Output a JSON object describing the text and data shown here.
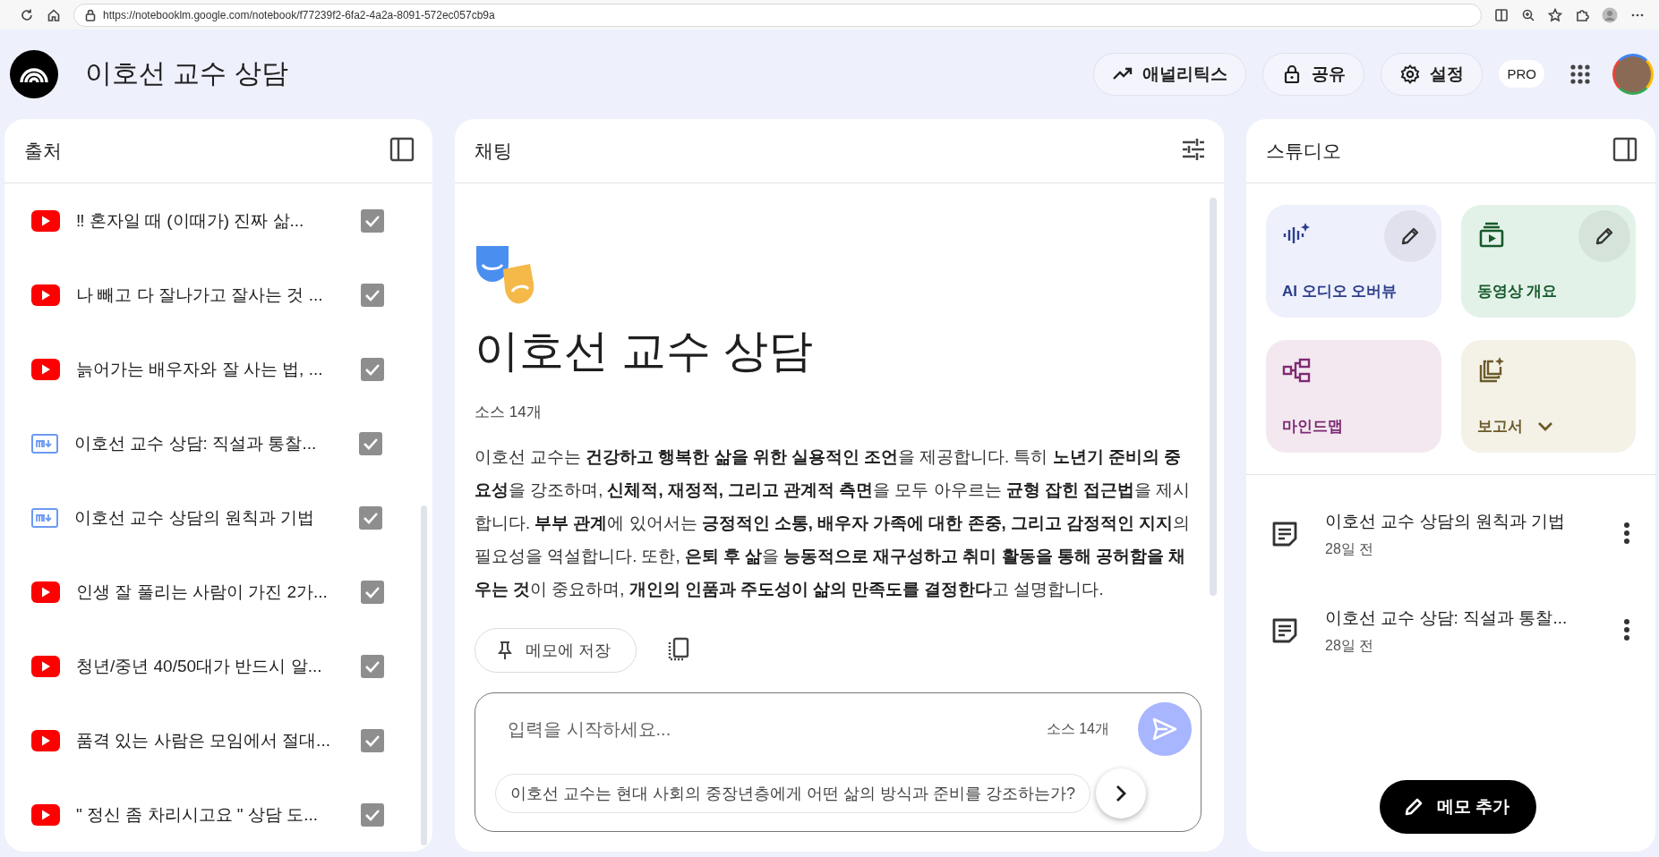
{
  "browser": {
    "url": "https://notebooklm.google.com/notebook/f77239f2-6fa2-4a2a-8091-572ec057cb9a"
  },
  "header": {
    "title": "이호선 교수 상담",
    "buttons": [
      {
        "kind": "analytics",
        "label": "애널리틱스"
      },
      {
        "kind": "share",
        "label": "공유"
      },
      {
        "kind": "settings",
        "label": "설정"
      }
    ],
    "badge": "PRO"
  },
  "sources": {
    "title": "출처",
    "items": [
      {
        "kind": "youtube",
        "title": "‼ 혼자일 때 (이때가) 진짜 삶...",
        "checked": true
      },
      {
        "kind": "youtube",
        "title": "나 빼고 다 잘나가고 잘사는 것 ...",
        "checked": true
      },
      {
        "kind": "youtube",
        "title": "늙어가는 배우자와 잘 사는 법, ...",
        "checked": true
      },
      {
        "kind": "document",
        "title": "이호선 교수 상담: 직설과 통찰...",
        "checked": true
      },
      {
        "kind": "document",
        "title": "이호선 교수 상담의 원칙과 기법",
        "checked": true
      },
      {
        "kind": "youtube",
        "title": "인생 잘 풀리는 사람이 가진 2가...",
        "checked": true
      },
      {
        "kind": "youtube",
        "title": "청년/중년 40/50대가 반드시 알...",
        "checked": true
      },
      {
        "kind": "youtube",
        "title": "품격 있는 사람은 모임에서 절대...",
        "checked": true
      },
      {
        "kind": "youtube",
        "title": "\" 정신 좀 차리시고요 \"  상담 도...",
        "checked": true
      }
    ]
  },
  "chat": {
    "title": "채팅",
    "notebook_title": "이호선 교수 상담",
    "source_count": "소스 14개",
    "summary": "이호선 교수는 **건강하고 행복한 삶을 위한 실용적인 조언**을 제공합니다. 특히 **노년기 준비의 중요성**을 강조하며, **신체적, 재정적, 그리고 관계적 측면**을 모두 아우르는 **균형 잡힌 접근법**을 제시합니다. **부부 관계**에 있어서는 **긍정적인 소통, 배우자 가족에 대한 존중, 그리고 감정적인 지지**의 필요성을 역설합니다. 또한, **은퇴 후 삶**을 **능동적으로 재구성하고 취미 활동을 통해 공허함을 채우는 것**이 중요하며, **개인의 인품과 주도성이 삶의 만족도를 결정한다**고 설명합니다.",
    "save_button": "메모에 저장",
    "input": {
      "placeholder": "입력을 시작하세요...",
      "source_count": "소스 14개"
    },
    "suggestion": "이호선 교수는 현대 사회의 중장년층에게 어떤 삶의 방식과 준비를 강조하는가?"
  },
  "studio": {
    "title": "스튜디오",
    "tiles": [
      {
        "kind": "audio",
        "label": "AI 오디오 오버뷰",
        "color": "#eef0fb",
        "editable": true,
        "dropdown": false
      },
      {
        "kind": "video",
        "label": "동영상 개요",
        "color": "#e3f2e8",
        "editable": true,
        "dropdown": false
      },
      {
        "kind": "mindmap",
        "label": "마인드맵",
        "color": "#f3e8f0",
        "editable": false,
        "dropdown": false
      },
      {
        "kind": "report",
        "label": "보고서",
        "color": "#f4f2e7",
        "editable": false,
        "dropdown": true
      }
    ],
    "notes": [
      {
        "title": "이호선 교수 상담의 원칙과 기법",
        "time": "28일 전"
      },
      {
        "title": "이호선 교수 상담: 직설과 통찰...",
        "time": "28일 전"
      }
    ],
    "add_button": "메모 추가"
  }
}
